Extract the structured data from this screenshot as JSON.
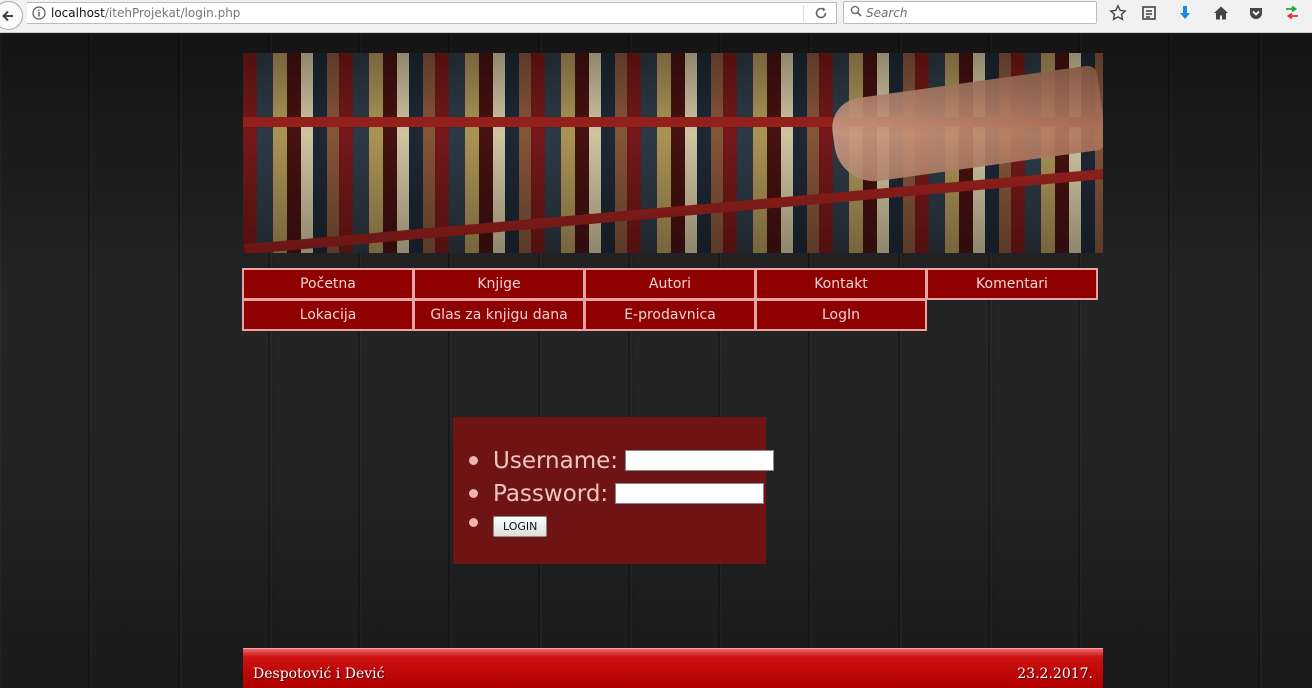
{
  "browser": {
    "url_host": "localhost",
    "url_path": "/itehProjekat/login.php",
    "search_placeholder": "Search"
  },
  "nav": {
    "row1": [
      "Početna",
      "Knjige",
      "Autori",
      "Kontakt",
      "Komentari"
    ],
    "row2": [
      "Lokacija",
      "Glas za knjigu dana",
      "E-prodavnica",
      "LogIn"
    ]
  },
  "login": {
    "username_label": "Username:",
    "username_value": "",
    "password_label": "Password:",
    "password_value": "",
    "button_label": "LOGIN"
  },
  "footer": {
    "authors": "Despotović i Dević",
    "date": "23.2.2017."
  },
  "colors": {
    "nav_bg": "#8f0000",
    "nav_border": "#e8a3a3",
    "login_bg": "#6e1414",
    "footer_bg": "#b10000"
  }
}
